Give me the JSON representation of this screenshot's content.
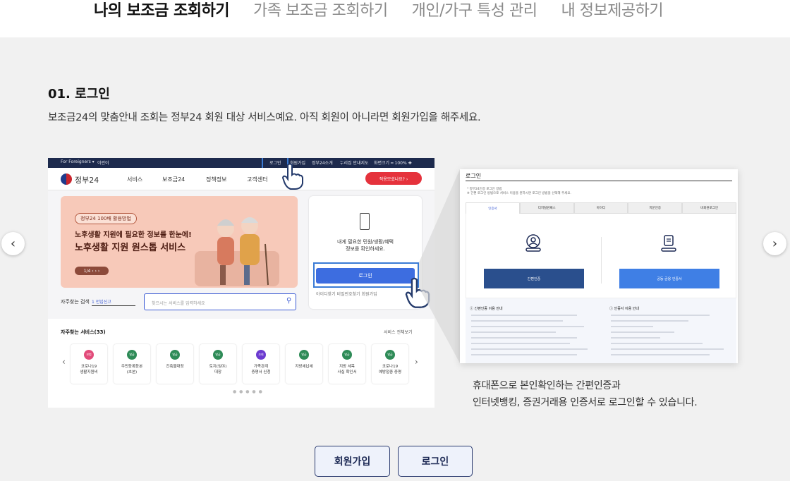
{
  "tabs": [
    {
      "label": "나의 보조금 조회하기",
      "active": true
    },
    {
      "label": "가족 보조금 조회하기",
      "active": false
    },
    {
      "label": "개인/가구 특성 관리",
      "active": false
    },
    {
      "label": "내 정보제공하기",
      "active": false
    }
  ],
  "step": {
    "title": "01. 로그인",
    "description": "보조금24의 맞춤안내 조회는 정부24 회원 대상 서비스예요. 아직 회원이 아니라면 회원가입을 해주세요."
  },
  "mock_site": {
    "topstrip": {
      "foreigner": "For Foreigners ▾",
      "easy": "이런이",
      "login": "로그인",
      "join": "회원가입",
      "sitemap": "정부24소개",
      "guide": "누리집 안내지도",
      "zoom": "화면크기 ━ 100% ✚"
    },
    "logo_text": "정부24",
    "nav": [
      "서비스",
      "보조금24",
      "정책정보",
      "고객센터"
    ],
    "red_button": "적용모셨나요? ›",
    "banner": {
      "pill": "정부24 100배 활용방법",
      "line1": "노후생활 지원에 필요한 정보를 한눈에!",
      "line2": "노후생활 지원 원스톱 서비스",
      "pager": "1/4 ‹ ›  ›"
    },
    "login_card": {
      "message_line1": "내게 필요한 민원/생활/혜택",
      "message_line2": "정보를 확인하세요.",
      "button": "로그인",
      "links": "아이디찾기   비밀번호찾기           회원가입"
    },
    "search": {
      "label": "자주찾는 검색",
      "select": "1 전입신고",
      "placeholder": "찾으시는 서비스를 입력하세요"
    },
    "services": {
      "header": "자주찾는 서비스(33)",
      "more": "서비스 전체보기",
      "items": [
        {
          "tag": "보험",
          "name1": "코로나19",
          "name2": "생활지원비",
          "color": "#e24b7a"
        },
        {
          "tag": "발급",
          "name1": "주민등록등본",
          "name2": "(초본)",
          "color": "#2e8b57"
        },
        {
          "tag": "발급",
          "name1": "건축물대장",
          "name2": "",
          "color": "#2e8b57"
        },
        {
          "tag": "발급",
          "name1": "토지(임야)",
          "name2": "대장",
          "color": "#2e8b57"
        },
        {
          "tag": "조회",
          "name1": "가족관계",
          "name2": "증명서 신청",
          "color": "#6c3bd0"
        },
        {
          "tag": "발급",
          "name1": "지방세납세",
          "name2": "",
          "color": "#2e8b57"
        },
        {
          "tag": "발급",
          "name1": "지방 세목",
          "name2": "사실 확인서",
          "color": "#2e8b57"
        },
        {
          "tag": "발급",
          "name1": "코로나19",
          "name2": "예방접종 증명",
          "color": "#2e8b57"
        }
      ]
    }
  },
  "login_page": {
    "title": "로그인",
    "note1": "* 정부24인증 로그인 방법",
    "note2": "※ 간편 로그인 방법으로 서비스 이용을 원하시면 로그인 방법을 선택해 주세요.",
    "tabs": [
      "인증서",
      "디지털원패스",
      "아이디",
      "지문인증",
      "비회원로그인"
    ],
    "button_simple": "간편인증",
    "button_cert": "공동·금융 인증서",
    "info_left": "ⓘ 간편인증 이용 안내",
    "info_right": "ⓘ 인증서 이용 안내"
  },
  "caption": {
    "line1": "휴대폰으로 본인확인하는 간편인증과",
    "line2": "인터넷뱅킹, 증권거래용 인증서로 로그인할 수 있습니다."
  },
  "buttons": {
    "join": "회원가입",
    "login": "로그인"
  },
  "colors": {
    "accent_blue": "#3a7bd5",
    "cta_border": "#2a3a6e",
    "red": "#e5323c"
  }
}
